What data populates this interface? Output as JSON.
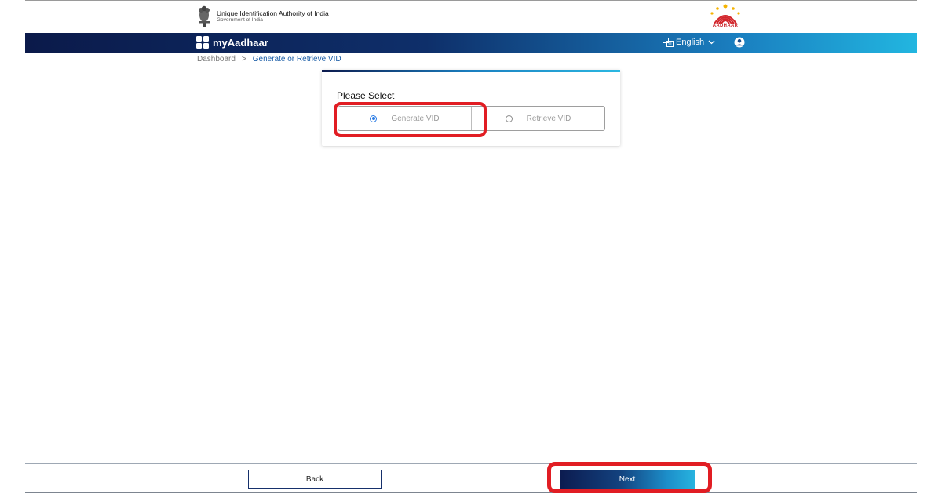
{
  "header": {
    "org_name": "Unique Identification Authority of India",
    "org_sub": "Government of India",
    "logo_text": "AADHAAR"
  },
  "navbar": {
    "brand": "myAadhaar",
    "language": "English",
    "icons": [
      "grid-icon",
      "language-icon",
      "chevron-down-icon",
      "user-icon"
    ]
  },
  "breadcrumb": {
    "home": "Dashboard",
    "separator": ">",
    "current": "Generate or Retrieve VID"
  },
  "card": {
    "title": "Please Select",
    "options": [
      {
        "label": "Generate VID",
        "selected": true
      },
      {
        "label": "Retrieve VID",
        "selected": false
      }
    ]
  },
  "footer": {
    "back_label": "Back",
    "next_label": "Next"
  },
  "colors": {
    "nav_start": "#0b1a4a",
    "nav_end": "#22b6e0",
    "highlight": "#e11d23",
    "link": "#1d5fa8",
    "radio_selected": "#2a7be4"
  }
}
